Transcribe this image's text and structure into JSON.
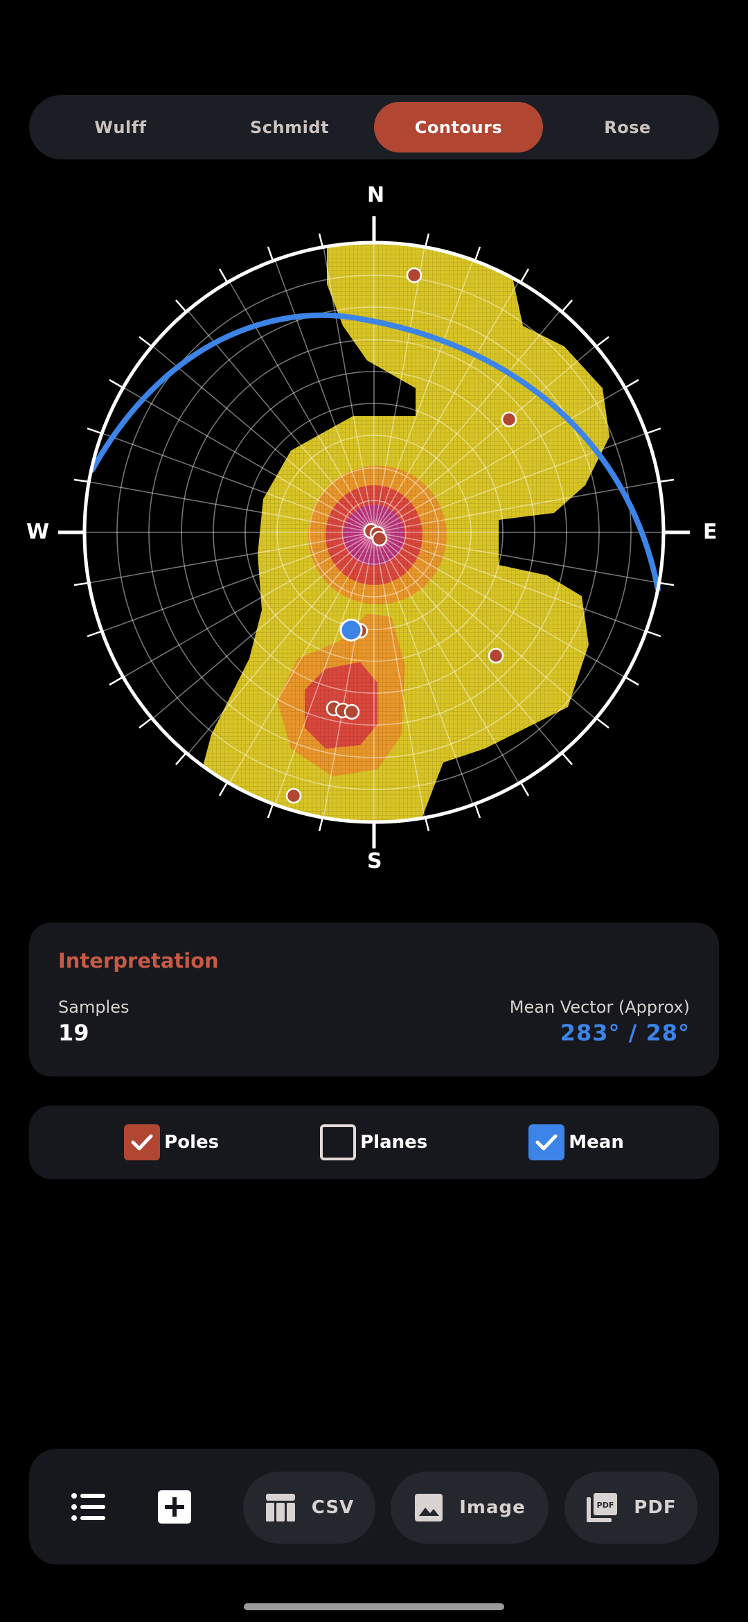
{
  "tabs": [
    {
      "label": "Wulff",
      "active": false
    },
    {
      "label": "Schmidt",
      "active": false
    },
    {
      "label": "Contours",
      "active": true
    },
    {
      "label": "Rose",
      "active": false
    }
  ],
  "stereonet": {
    "directions": {
      "north": "N",
      "south": "S",
      "east": "E",
      "west": "W"
    }
  },
  "interpretation": {
    "title": "Interpretation",
    "samples_label": "Samples",
    "samples_value": "19",
    "mean_label": "Mean Vector (Approx)",
    "mean_value": "283° / 28°"
  },
  "toggles": {
    "poles": {
      "label": "Poles",
      "checked": true
    },
    "planes": {
      "label": "Planes",
      "checked": false
    },
    "mean": {
      "label": "Mean",
      "checked": true
    }
  },
  "toolbar": {
    "list_icon": "list-icon",
    "add_icon": "add-box-icon",
    "csv_label": "CSV",
    "image_label": "Image",
    "pdf_label": "PDF"
  },
  "colors": {
    "accent": "#b14633",
    "mean_blue": "#3d84e8",
    "contour_yellow": "#d8c426",
    "contour_orange": "#e8962a",
    "contour_red": "#d9473c",
    "contour_magenta": "#b8357a"
  }
}
